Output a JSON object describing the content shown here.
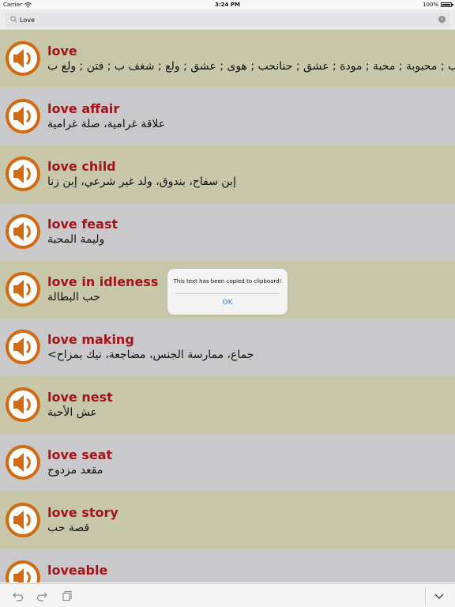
{
  "status_bar": {
    "carrier": "Carrier",
    "time": "3:24 PM",
    "battery": "100%"
  },
  "search": {
    "value": "Love",
    "placeholder": ""
  },
  "results": [
    {
      "word": "love",
      "translation": "حب ; محبوبة ; محبة ; مودة ; عشق ; حنانحب ; هوى ; عشق ; ولع ; شغف ب ; فتن ; ولع ب"
    },
    {
      "word": "love affair",
      "translation": "علاقة غرامية، صلة غرامية"
    },
    {
      "word": "love child",
      "translation": "إبن سفاح، بندوق، ولد غير شرعي، إبن زنا"
    },
    {
      "word": "love feast",
      "translation": "وليمة المحبة"
    },
    {
      "word": "love in idleness",
      "translation": "حب البطالة"
    },
    {
      "word": "love making",
      "translation": "جماع، ممارسة الجنس، مضاجعة، نيك بمزاح>"
    },
    {
      "word": "love nest",
      "translation": "عش الأحبة"
    },
    {
      "word": "love seat",
      "translation": "مقعد مزدوج"
    },
    {
      "word": "love story",
      "translation": "قصة حب"
    },
    {
      "word": "loveable",
      "translation": ""
    }
  ],
  "alert": {
    "message": "This text has been copied to clipboard!",
    "ok_label": "OK"
  },
  "icons": {
    "speaker": "speaker-icon",
    "undo": "undo-icon",
    "redo": "redo-icon",
    "paste": "paste-icon",
    "collapse": "chevron-down-icon"
  },
  "colors": {
    "word": "#a3141a",
    "speaker": "#d26a12",
    "row_odd": "#c8c7a9",
    "row_even": "#c9c8cb",
    "alert_button": "#2b84f0"
  }
}
